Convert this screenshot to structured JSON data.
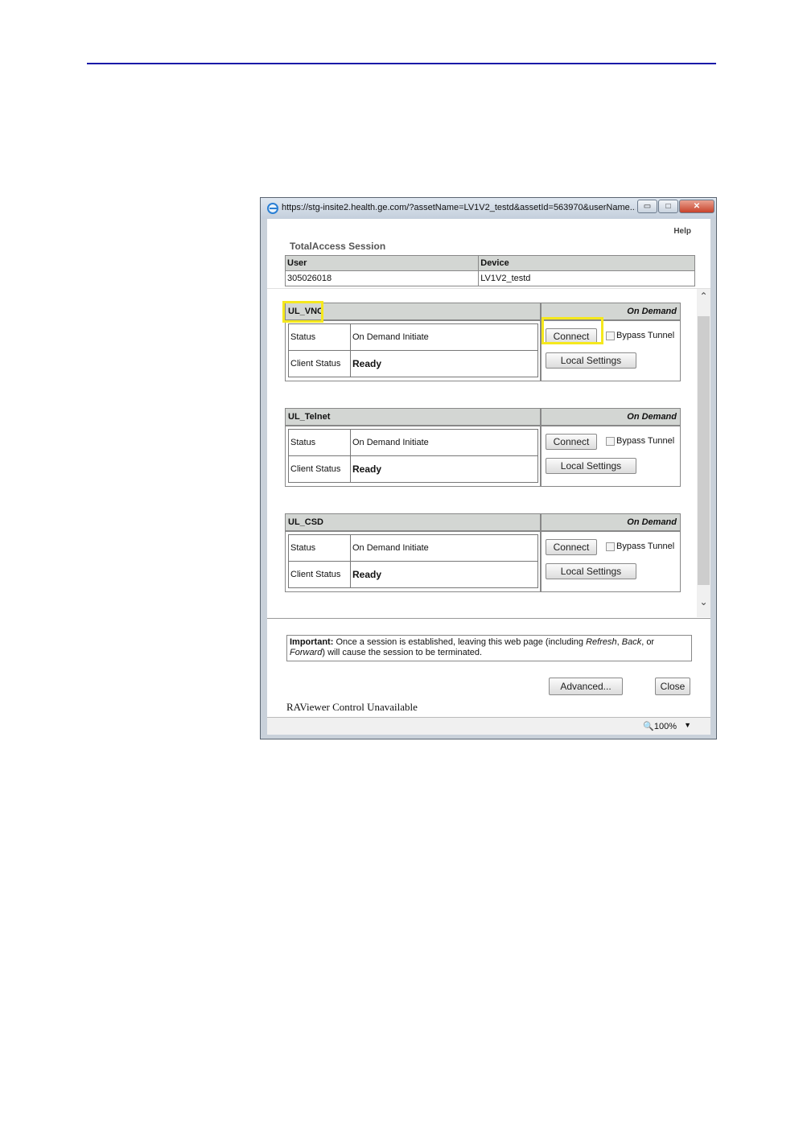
{
  "browser": {
    "url": "https://stg-insite2.health.ge.com/?assetName=LV1V2_testd&assetId=563970&userName...",
    "minimize": "▭",
    "maximize": "□",
    "close": "✕",
    "zoom": "100%"
  },
  "page": {
    "help": "Help",
    "title": "TotalAccess Session",
    "info_headers": [
      "User",
      "Device"
    ],
    "info_values": [
      "305026018",
      "LV1V2_testd"
    ]
  },
  "sessions": [
    {
      "name": "UL_VNC",
      "mode": "On Demand",
      "status_label": "Status",
      "status_value": "On Demand Initiate",
      "client_label": "Client Status",
      "client_value": "Ready",
      "connect": "Connect",
      "bypass": "Bypass Tunnel",
      "local": "Local Settings"
    },
    {
      "name": "UL_Telnet",
      "mode": "On Demand",
      "status_label": "Status",
      "status_value": "On Demand Initiate",
      "client_label": "Client Status",
      "client_value": "Ready",
      "connect": "Connect",
      "bypass": "Bypass Tunnel",
      "local": "Local Settings"
    },
    {
      "name": "UL_CSD",
      "mode": "On Demand",
      "status_label": "Status",
      "status_value": "On Demand Initiate",
      "client_label": "Client Status",
      "client_value": "Ready",
      "connect": "Connect",
      "bypass": "Bypass Tunnel",
      "local": "Local Settings"
    }
  ],
  "notice": {
    "bold": "Important:",
    "text1": " Once a session is established, leaving this web page (including ",
    "refresh": "Refresh",
    "sep1": ", ",
    "back": "Back",
    "sep2": ", or",
    "forward": "Forward",
    "text2": ") will cause the session to be terminated."
  },
  "buttons": {
    "advanced": "Advanced...",
    "close": "Close"
  },
  "raviewer": "RAViewer Control Unavailable",
  "colors": {
    "rule": "#1a1aa8",
    "highlight": "#f5e81e"
  }
}
